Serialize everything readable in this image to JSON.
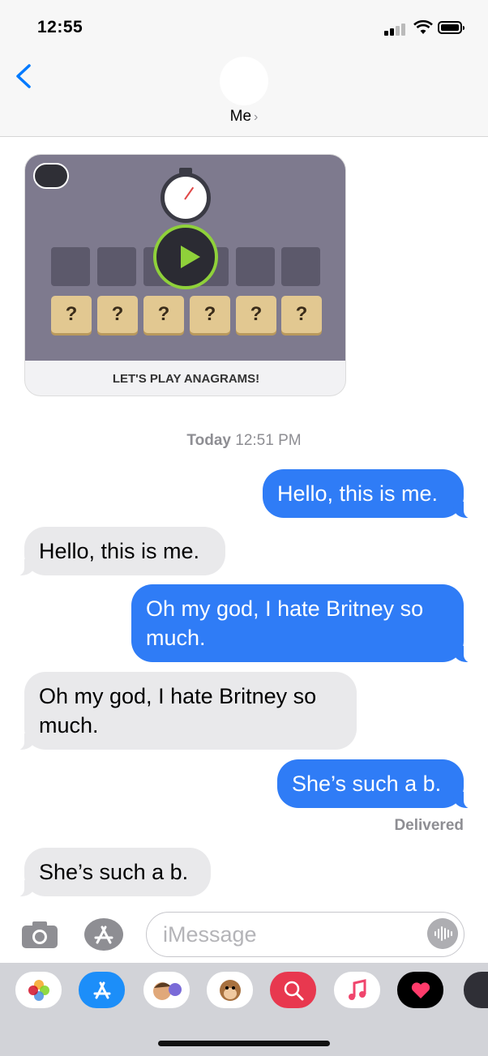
{
  "status_bar": {
    "time": "12:55"
  },
  "header": {
    "contact_name": "Me",
    "chevron": "›",
    "back_icon": "chevron-left-icon"
  },
  "app_card": {
    "caption": "LET'S PLAY ANAGRAMS!",
    "tiles": [
      "?",
      "?",
      "?",
      "?",
      "?",
      "?"
    ]
  },
  "timestamp": {
    "day": "Today",
    "time": "12:51 PM"
  },
  "messages": [
    {
      "direction": "sent",
      "text": "Hello, this is me."
    },
    {
      "direction": "received",
      "text": "Hello, this is me."
    },
    {
      "direction": "sent",
      "text": "Oh my god, I hate Britney so much."
    },
    {
      "direction": "received",
      "text": "Oh my god, I hate Britney so much."
    },
    {
      "direction": "sent",
      "text": "She’s such a b."
    },
    {
      "direction": "received",
      "text": "She’s such a b."
    }
  ],
  "delivery_status": "Delivered",
  "composer": {
    "placeholder": "iMessage"
  },
  "app_drawer": [
    "photos-app-icon",
    "appstore-app-icon",
    "memoji-app-icon",
    "animoji-app-icon",
    "search-images-app-icon",
    "music-app-icon",
    "digital-touch-app-icon",
    "gamepigeon-app-icon"
  ],
  "colors": {
    "sent_bubble": "#2f7cf6",
    "received_bubble": "#e9e9eb",
    "accent": "#007aff"
  }
}
